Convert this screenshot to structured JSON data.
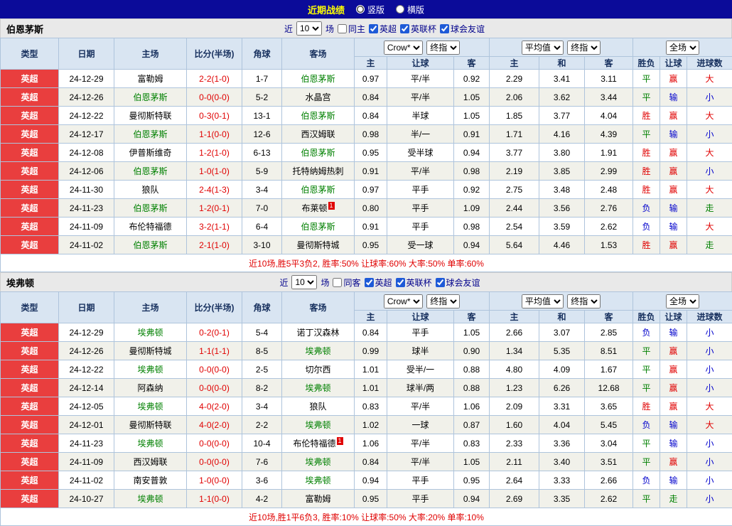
{
  "topbar": {
    "title": "近期战绩",
    "modes": [
      {
        "label": "竖版",
        "selected": true
      },
      {
        "label": "横版",
        "selected": false
      }
    ]
  },
  "labels": {
    "near": "近",
    "matches": "场"
  },
  "table_header": {
    "cols": [
      "类型",
      "日期",
      "主场",
      "比分(半场)",
      "角球",
      "客场"
    ],
    "odds_company_select": "Crow*",
    "odds_type_select": "终指",
    "avg_select": "平均值",
    "avg_type_select": "终指",
    "scope_select": "全场",
    "sub": [
      "主",
      "让球",
      "客",
      "主",
      "和",
      "客",
      "胜负",
      "让球",
      "进球数"
    ]
  },
  "colors": {
    "topbar_bg": "#0b0b99",
    "title_yellow": "#ffff00",
    "header_bg": "#d9e5f2",
    "league_red": "#e93e3e",
    "focus_team_green": "#008000",
    "score_red": "#e00000",
    "result_win": "#e00000",
    "result_draw": "#008000",
    "result_lose": "#0000cc"
  },
  "sections": [
    {
      "team": "伯恩茅斯",
      "filters": {
        "count": "10",
        "same_label": "同主",
        "same_checked": false,
        "leagues": [
          {
            "label": "英超",
            "checked": true
          },
          {
            "label": "英联杯",
            "checked": true
          },
          {
            "label": "球会友谊",
            "checked": true
          }
        ]
      },
      "rows": [
        {
          "league": "英超",
          "date": "24-12-29",
          "home": "富勒姆",
          "home_focus": false,
          "home_redcard": "",
          "score": "2-2(1-0)",
          "corner": "1-7",
          "away": "伯恩茅斯",
          "away_focus": true,
          "away_redcard": "",
          "odds_home": "0.97",
          "handicap": "平/半",
          "odds_away": "0.92",
          "avg_home": "2.29",
          "avg_draw": "3.41",
          "avg_away": "3.11",
          "result": "平",
          "result_color": "draw",
          "handicap_result": "赢",
          "handicap_color": "win",
          "goals": "大",
          "goals_color": "win"
        },
        {
          "league": "英超",
          "date": "24-12-26",
          "home": "伯恩茅斯",
          "home_focus": true,
          "home_redcard": "",
          "score": "0-0(0-0)",
          "corner": "5-2",
          "away": "水晶宫",
          "away_focus": false,
          "away_redcard": "",
          "odds_home": "0.84",
          "handicap": "平/半",
          "odds_away": "1.05",
          "avg_home": "2.06",
          "avg_draw": "3.62",
          "avg_away": "3.44",
          "result": "平",
          "result_color": "draw",
          "handicap_result": "输",
          "handicap_color": "lose",
          "goals": "小",
          "goals_color": "lose"
        },
        {
          "league": "英超",
          "date": "24-12-22",
          "home": "曼彻斯特联",
          "home_focus": false,
          "home_redcard": "",
          "score": "0-3(0-1)",
          "corner": "13-1",
          "away": "伯恩茅斯",
          "away_focus": true,
          "away_redcard": "",
          "odds_home": "0.84",
          "handicap": "半球",
          "odds_away": "1.05",
          "avg_home": "1.85",
          "avg_draw": "3.77",
          "avg_away": "4.04",
          "result": "胜",
          "result_color": "win",
          "handicap_result": "赢",
          "handicap_color": "win",
          "goals": "大",
          "goals_color": "win"
        },
        {
          "league": "英超",
          "date": "24-12-17",
          "home": "伯恩茅斯",
          "home_focus": true,
          "home_redcard": "",
          "score": "1-1(0-0)",
          "corner": "12-6",
          "away": "西汉姆联",
          "away_focus": false,
          "away_redcard": "",
          "odds_home": "0.98",
          "handicap": "半/一",
          "odds_away": "0.91",
          "avg_home": "1.71",
          "avg_draw": "4.16",
          "avg_away": "4.39",
          "result": "平",
          "result_color": "draw",
          "handicap_result": "输",
          "handicap_color": "lose",
          "goals": "小",
          "goals_color": "lose"
        },
        {
          "league": "英超",
          "date": "24-12-08",
          "home": "伊普斯维奇",
          "home_focus": false,
          "home_redcard": "",
          "score": "1-2(1-0)",
          "corner": "6-13",
          "away": "伯恩茅斯",
          "away_focus": true,
          "away_redcard": "",
          "odds_home": "0.95",
          "handicap": "受半球",
          "odds_away": "0.94",
          "avg_home": "3.77",
          "avg_draw": "3.80",
          "avg_away": "1.91",
          "result": "胜",
          "result_color": "win",
          "handicap_result": "赢",
          "handicap_color": "win",
          "goals": "大",
          "goals_color": "win"
        },
        {
          "league": "英超",
          "date": "24-12-06",
          "home": "伯恩茅斯",
          "home_focus": true,
          "home_redcard": "",
          "score": "1-0(1-0)",
          "corner": "5-9",
          "away": "托特纳姆热刺",
          "away_focus": false,
          "away_redcard": "",
          "odds_home": "0.91",
          "handicap": "平/半",
          "odds_away": "0.98",
          "avg_home": "2.19",
          "avg_draw": "3.85",
          "avg_away": "2.99",
          "result": "胜",
          "result_color": "win",
          "handicap_result": "赢",
          "handicap_color": "win",
          "goals": "小",
          "goals_color": "lose"
        },
        {
          "league": "英超",
          "date": "24-11-30",
          "home": "狼队",
          "home_focus": false,
          "home_redcard": "",
          "score": "2-4(1-3)",
          "corner": "3-4",
          "away": "伯恩茅斯",
          "away_focus": true,
          "away_redcard": "",
          "odds_home": "0.97",
          "handicap": "平手",
          "odds_away": "0.92",
          "avg_home": "2.75",
          "avg_draw": "3.48",
          "avg_away": "2.48",
          "result": "胜",
          "result_color": "win",
          "handicap_result": "赢",
          "handicap_color": "win",
          "goals": "大",
          "goals_color": "win"
        },
        {
          "league": "英超",
          "date": "24-11-23",
          "home": "伯恩茅斯",
          "home_focus": true,
          "home_redcard": "",
          "score": "1-2(0-1)",
          "corner": "7-0",
          "away": "布莱顿",
          "away_focus": false,
          "away_redcard": "1",
          "odds_home": "0.80",
          "handicap": "平手",
          "odds_away": "1.09",
          "avg_home": "2.44",
          "avg_draw": "3.56",
          "avg_away": "2.76",
          "result": "负",
          "result_color": "lose",
          "handicap_result": "输",
          "handicap_color": "lose",
          "goals": "走",
          "goals_color": "draw"
        },
        {
          "league": "英超",
          "date": "24-11-09",
          "home": "布伦特福德",
          "home_focus": false,
          "home_redcard": "",
          "score": "3-2(1-1)",
          "corner": "6-4",
          "away": "伯恩茅斯",
          "away_focus": true,
          "away_redcard": "",
          "odds_home": "0.91",
          "handicap": "平手",
          "odds_away": "0.98",
          "avg_home": "2.54",
          "avg_draw": "3.59",
          "avg_away": "2.62",
          "result": "负",
          "result_color": "lose",
          "handicap_result": "输",
          "handicap_color": "lose",
          "goals": "大",
          "goals_color": "win"
        },
        {
          "league": "英超",
          "date": "24-11-02",
          "home": "伯恩茅斯",
          "home_focus": true,
          "home_redcard": "",
          "score": "2-1(1-0)",
          "corner": "3-10",
          "away": "曼彻斯特城",
          "away_focus": false,
          "away_redcard": "",
          "odds_home": "0.95",
          "handicap": "受一球",
          "odds_away": "0.94",
          "avg_home": "5.64",
          "avg_draw": "4.46",
          "avg_away": "1.53",
          "result": "胜",
          "result_color": "win",
          "handicap_result": "赢",
          "handicap_color": "win",
          "goals": "走",
          "goals_color": "draw"
        }
      ],
      "summary": "近10场,胜5平3负2, 胜率:50% 让球率:60% 大率:50% 单率:60%"
    },
    {
      "team": "埃弗顿",
      "filters": {
        "count": "10",
        "same_label": "同客",
        "same_checked": false,
        "leagues": [
          {
            "label": "英超",
            "checked": true
          },
          {
            "label": "英联杯",
            "checked": true
          },
          {
            "label": "球会友谊",
            "checked": true
          }
        ]
      },
      "rows": [
        {
          "league": "英超",
          "date": "24-12-29",
          "home": "埃弗顿",
          "home_focus": true,
          "home_redcard": "",
          "score": "0-2(0-1)",
          "corner": "5-4",
          "away": "诺丁汉森林",
          "away_focus": false,
          "away_redcard": "",
          "odds_home": "0.84",
          "handicap": "平手",
          "odds_away": "1.05",
          "avg_home": "2.66",
          "avg_draw": "3.07",
          "avg_away": "2.85",
          "result": "负",
          "result_color": "lose",
          "handicap_result": "输",
          "handicap_color": "lose",
          "goals": "小",
          "goals_color": "lose"
        },
        {
          "league": "英超",
          "date": "24-12-26",
          "home": "曼彻斯特城",
          "home_focus": false,
          "home_redcard": "",
          "score": "1-1(1-1)",
          "corner": "8-5",
          "away": "埃弗顿",
          "away_focus": true,
          "away_redcard": "",
          "odds_home": "0.99",
          "handicap": "球半",
          "odds_away": "0.90",
          "avg_home": "1.34",
          "avg_draw": "5.35",
          "avg_away": "8.51",
          "result": "平",
          "result_color": "draw",
          "handicap_result": "赢",
          "handicap_color": "win",
          "goals": "小",
          "goals_color": "lose"
        },
        {
          "league": "英超",
          "date": "24-12-22",
          "home": "埃弗顿",
          "home_focus": true,
          "home_redcard": "",
          "score": "0-0(0-0)",
          "corner": "2-5",
          "away": "切尔西",
          "away_focus": false,
          "away_redcard": "",
          "odds_home": "1.01",
          "handicap": "受半/一",
          "odds_away": "0.88",
          "avg_home": "4.80",
          "avg_draw": "4.09",
          "avg_away": "1.67",
          "result": "平",
          "result_color": "draw",
          "handicap_result": "赢",
          "handicap_color": "win",
          "goals": "小",
          "goals_color": "lose"
        },
        {
          "league": "英超",
          "date": "24-12-14",
          "home": "阿森纳",
          "home_focus": false,
          "home_redcard": "",
          "score": "0-0(0-0)",
          "corner": "8-2",
          "away": "埃弗顿",
          "away_focus": true,
          "away_redcard": "",
          "odds_home": "1.01",
          "handicap": "球半/两",
          "odds_away": "0.88",
          "avg_home": "1.23",
          "avg_draw": "6.26",
          "avg_away": "12.68",
          "result": "平",
          "result_color": "draw",
          "handicap_result": "赢",
          "handicap_color": "win",
          "goals": "小",
          "goals_color": "lose"
        },
        {
          "league": "英超",
          "date": "24-12-05",
          "home": "埃弗顿",
          "home_focus": true,
          "home_redcard": "",
          "score": "4-0(2-0)",
          "corner": "3-4",
          "away": "狼队",
          "away_focus": false,
          "away_redcard": "",
          "odds_home": "0.83",
          "handicap": "平/半",
          "odds_away": "1.06",
          "avg_home": "2.09",
          "avg_draw": "3.31",
          "avg_away": "3.65",
          "result": "胜",
          "result_color": "win",
          "handicap_result": "赢",
          "handicap_color": "win",
          "goals": "大",
          "goals_color": "win"
        },
        {
          "league": "英超",
          "date": "24-12-01",
          "home": "曼彻斯特联",
          "home_focus": false,
          "home_redcard": "",
          "score": "4-0(2-0)",
          "corner": "2-2",
          "away": "埃弗顿",
          "away_focus": true,
          "away_redcard": "",
          "odds_home": "1.02",
          "handicap": "一球",
          "odds_away": "0.87",
          "avg_home": "1.60",
          "avg_draw": "4.04",
          "avg_away": "5.45",
          "result": "负",
          "result_color": "lose",
          "handicap_result": "输",
          "handicap_color": "lose",
          "goals": "大",
          "goals_color": "win"
        },
        {
          "league": "英超",
          "date": "24-11-23",
          "home": "埃弗顿",
          "home_focus": true,
          "home_redcard": "",
          "score": "0-0(0-0)",
          "corner": "10-4",
          "away": "布伦特福德",
          "away_focus": false,
          "away_redcard": "1",
          "odds_home": "1.06",
          "handicap": "平/半",
          "odds_away": "0.83",
          "avg_home": "2.33",
          "avg_draw": "3.36",
          "avg_away": "3.04",
          "result": "平",
          "result_color": "draw",
          "handicap_result": "输",
          "handicap_color": "lose",
          "goals": "小",
          "goals_color": "lose"
        },
        {
          "league": "英超",
          "date": "24-11-09",
          "home": "西汉姆联",
          "home_focus": false,
          "home_redcard": "",
          "score": "0-0(0-0)",
          "corner": "7-6",
          "away": "埃弗顿",
          "away_focus": true,
          "away_redcard": "",
          "odds_home": "0.84",
          "handicap": "平/半",
          "odds_away": "1.05",
          "avg_home": "2.11",
          "avg_draw": "3.40",
          "avg_away": "3.51",
          "result": "平",
          "result_color": "draw",
          "handicap_result": "赢",
          "handicap_color": "win",
          "goals": "小",
          "goals_color": "lose"
        },
        {
          "league": "英超",
          "date": "24-11-02",
          "home": "南安普敦",
          "home_focus": false,
          "home_redcard": "",
          "score": "1-0(0-0)",
          "corner": "3-6",
          "away": "埃弗顿",
          "away_focus": true,
          "away_redcard": "",
          "odds_home": "0.94",
          "handicap": "平手",
          "odds_away": "0.95",
          "avg_home": "2.64",
          "avg_draw": "3.33",
          "avg_away": "2.66",
          "result": "负",
          "result_color": "lose",
          "handicap_result": "输",
          "handicap_color": "lose",
          "goals": "小",
          "goals_color": "lose"
        },
        {
          "league": "英超",
          "date": "24-10-27",
          "home": "埃弗顿",
          "home_focus": true,
          "home_redcard": "",
          "score": "1-1(0-0)",
          "corner": "4-2",
          "away": "富勒姆",
          "away_focus": false,
          "away_redcard": "",
          "odds_home": "0.95",
          "handicap": "平手",
          "odds_away": "0.94",
          "avg_home": "2.69",
          "avg_draw": "3.35",
          "avg_away": "2.62",
          "result": "平",
          "result_color": "draw",
          "handicap_result": "走",
          "handicap_color": "draw",
          "goals": "小",
          "goals_color": "lose"
        }
      ],
      "summary": "近10场,胜1平6负3, 胜率:10% 让球率:50% 大率:20% 单率:10%"
    }
  ]
}
